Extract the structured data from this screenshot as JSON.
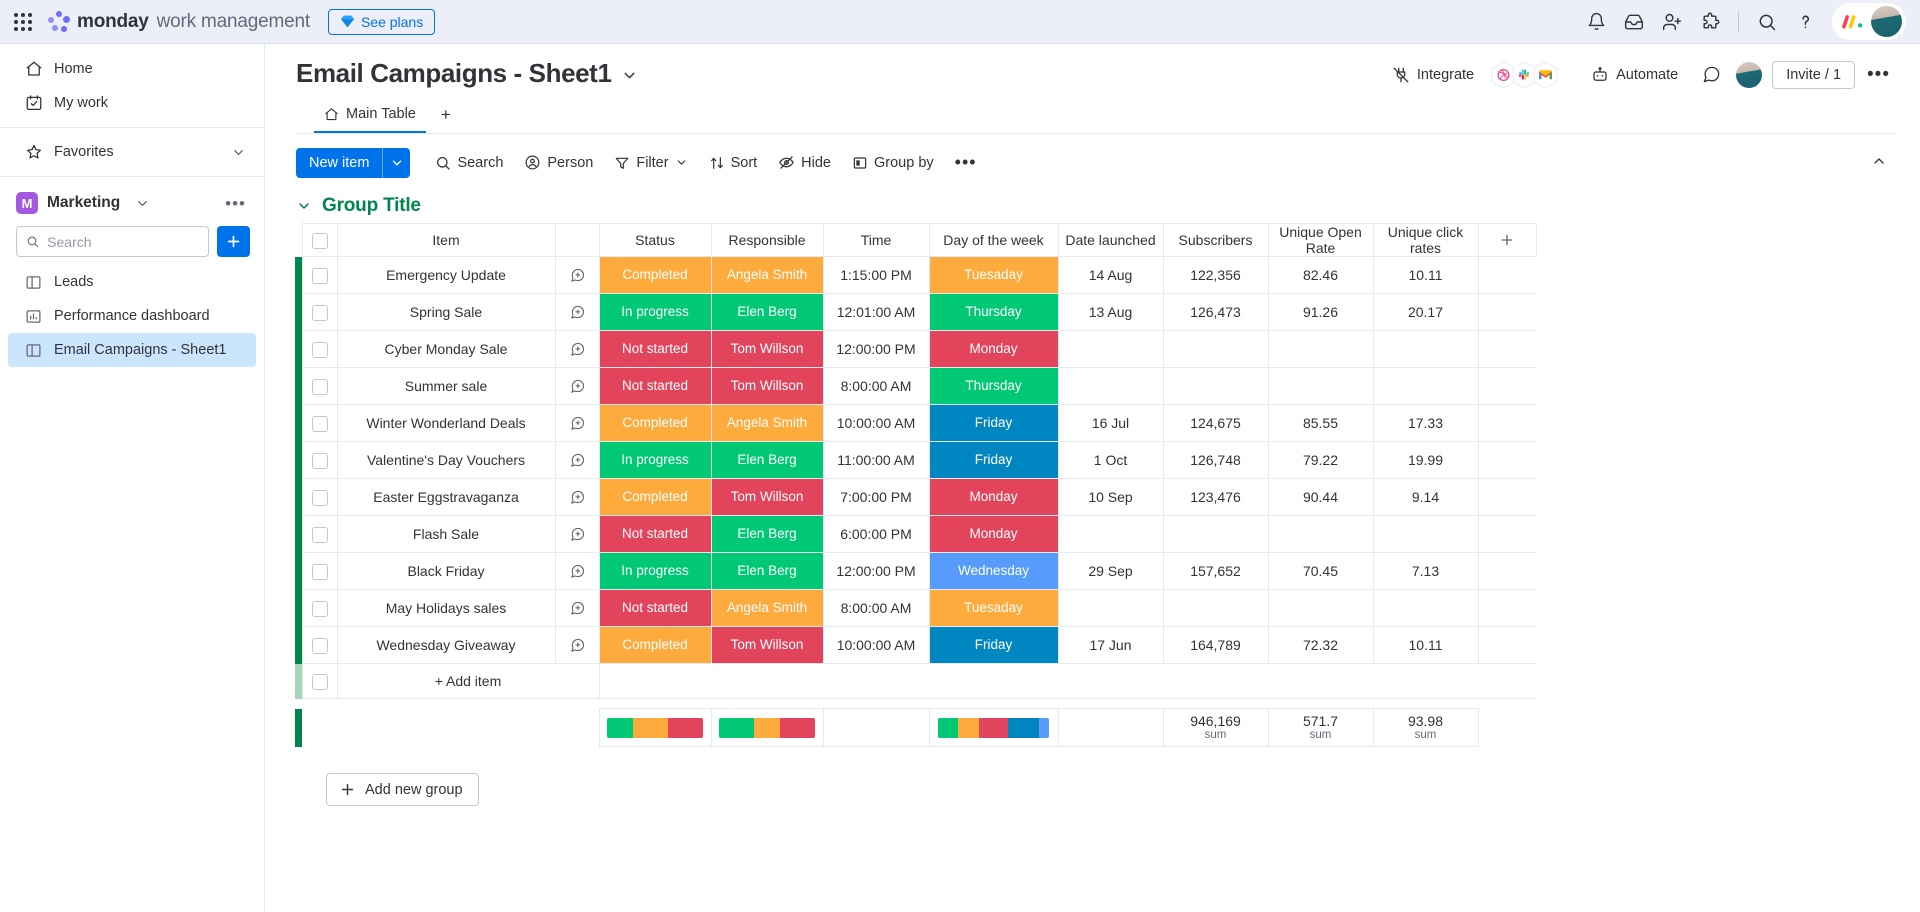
{
  "topbar": {
    "apps_icon": "apps-grid-icon",
    "brand_bold": "monday",
    "brand_light": "work management",
    "see_plans": "See plans",
    "icons": [
      "notifications-bell-icon",
      "inbox-icon",
      "invite-member-icon",
      "apps-puzzle-icon",
      "search-icon",
      "help-question-icon"
    ]
  },
  "sidebar": {
    "items": [
      {
        "label": "Home",
        "icon": "home-icon"
      },
      {
        "label": "My work",
        "icon": "my-work-icon"
      },
      {
        "label": "Favorites",
        "icon": "star-icon"
      }
    ],
    "workspace": {
      "badge": "M",
      "name": "Marketing"
    },
    "search_placeholder": "Search",
    "search_value": "",
    "add_label": "+",
    "boards": [
      {
        "label": "Leads",
        "icon": "board-icon",
        "active": false
      },
      {
        "label": "Performance dashboard",
        "icon": "dashboard-icon",
        "active": false
      },
      {
        "label": "Email Campaigns - Sheet1",
        "icon": "board-icon",
        "active": true
      }
    ]
  },
  "board": {
    "title": "Email Campaigns - Sheet1",
    "tabs": [
      {
        "label": "Main Table",
        "icon": "home-icon",
        "active": true
      }
    ],
    "tab_add": "+",
    "integrate_label": "Integrate",
    "integrate_apps": [
      "dribbble-icon",
      "slack-icon",
      "gmail-icon"
    ],
    "automate_label": "Automate",
    "comment_icon": "comment-icon",
    "invite_label": "Invite / 1",
    "more_label": "•••"
  },
  "toolbar": {
    "new_item": "New item",
    "buttons": [
      {
        "label": "Search",
        "icon": "search-icon",
        "chev": false
      },
      {
        "label": "Person",
        "icon": "person-icon",
        "chev": false
      },
      {
        "label": "Filter",
        "icon": "filter-icon",
        "chev": true
      },
      {
        "label": "Sort",
        "icon": "sort-icon",
        "chev": false
      },
      {
        "label": "Hide",
        "icon": "hide-eye-icon",
        "chev": false
      },
      {
        "label": "Group by",
        "icon": "group-by-icon",
        "chev": false
      }
    ],
    "more_label": "•••"
  },
  "group": {
    "title": "Group Title",
    "color": "#00854d"
  },
  "table": {
    "columns": [
      "Item",
      "Status",
      "Responsible",
      "Time",
      "Day of the week",
      "Date launched",
      "Subscribers",
      "Unique Open Rate",
      "Unique click rates"
    ],
    "add_column": "+",
    "add_item": "+ Add item",
    "rows": [
      {
        "item": "Emergency Update",
        "status": "Completed",
        "status_color": "#fdab3d",
        "responsible": "Angela Smith",
        "resp_color": "#fdab3d",
        "time": "1:15:00 PM",
        "dow": "Tuesaday",
        "dow_color": "#fdab3d",
        "date": "14 Aug",
        "subscribers": "122,356",
        "open_rate": "82.46",
        "click_rate": "10.11"
      },
      {
        "item": "Spring Sale",
        "status": "In progress",
        "status_color": "#00c875",
        "responsible": "Elen Berg",
        "resp_color": "#00c875",
        "time": "12:01:00 AM",
        "dow": "Thursday",
        "dow_color": "#00c875",
        "date": "13 Aug",
        "subscribers": "126,473",
        "open_rate": "91.26",
        "click_rate": "20.17"
      },
      {
        "item": "Cyber Monday Sale",
        "status": "Not started",
        "status_color": "#e2445c",
        "responsible": "Tom Willson",
        "resp_color": "#e2445c",
        "time": "12:00:00 PM",
        "dow": "Monday",
        "dow_color": "#e2445c",
        "date": "",
        "subscribers": "",
        "open_rate": "",
        "click_rate": ""
      },
      {
        "item": "Summer sale",
        "status": "Not started",
        "status_color": "#e2445c",
        "responsible": "Tom Willson",
        "resp_color": "#e2445c",
        "time": "8:00:00 AM",
        "dow": "Thursday",
        "dow_color": "#00c875",
        "date": "",
        "subscribers": "",
        "open_rate": "",
        "click_rate": ""
      },
      {
        "item": "Winter Wonderland Deals",
        "status": "Completed",
        "status_color": "#fdab3d",
        "responsible": "Angela Smith",
        "resp_color": "#fdab3d",
        "time": "10:00:00 AM",
        "dow": "Friday",
        "dow_color": "#0086c0",
        "date": "16 Jul",
        "subscribers": "124,675",
        "open_rate": "85.55",
        "click_rate": "17.33"
      },
      {
        "item": "Valentine's Day Vouchers",
        "status": "In progress",
        "status_color": "#00c875",
        "responsible": "Elen Berg",
        "resp_color": "#00c875",
        "time": "11:00:00 AM",
        "dow": "Friday",
        "dow_color": "#0086c0",
        "date": "1 Oct",
        "subscribers": "126,748",
        "open_rate": "79.22",
        "click_rate": "19.99"
      },
      {
        "item": "Easter Eggstravaganza",
        "status": "Completed",
        "status_color": "#fdab3d",
        "responsible": "Tom Willson",
        "resp_color": "#e2445c",
        "time": "7:00:00 PM",
        "dow": "Monday",
        "dow_color": "#e2445c",
        "date": "10 Sep",
        "subscribers": "123,476",
        "open_rate": "90.44",
        "click_rate": "9.14"
      },
      {
        "item": "Flash Sale",
        "status": "Not started",
        "status_color": "#e2445c",
        "responsible": "Elen Berg",
        "resp_color": "#00c875",
        "time": "6:00:00 PM",
        "dow": "Monday",
        "dow_color": "#e2445c",
        "date": "",
        "subscribers": "",
        "open_rate": "",
        "click_rate": ""
      },
      {
        "item": "Black Friday",
        "status": "In progress",
        "status_color": "#00c875",
        "responsible": "Elen Berg",
        "resp_color": "#00c875",
        "time": "12:00:00 PM",
        "dow": "Wednesday",
        "dow_color": "#579bfc",
        "date": "29 Sep",
        "subscribers": "157,652",
        "open_rate": "70.45",
        "click_rate": "7.13"
      },
      {
        "item": "May Holidays sales",
        "status": "Not started",
        "status_color": "#e2445c",
        "responsible": "Angela Smith",
        "resp_color": "#fdab3d",
        "time": "8:00:00 AM",
        "dow": "Tuesaday",
        "dow_color": "#fdab3d",
        "date": "",
        "subscribers": "",
        "open_rate": "",
        "click_rate": ""
      },
      {
        "item": "Wednesday Giveaway",
        "status": "Completed",
        "status_color": "#fdab3d",
        "responsible": "Tom Willson",
        "resp_color": "#e2445c",
        "time": "10:00:00 AM",
        "dow": "Friday",
        "dow_color": "#0086c0",
        "date": "17 Jun",
        "subscribers": "164,789",
        "open_rate": "72.32",
        "click_rate": "10.11"
      }
    ],
    "summary": {
      "status_bar": [
        {
          "color": "#00c875",
          "pct": 27.3
        },
        {
          "color": "#fdab3d",
          "pct": 36.4
        },
        {
          "color": "#e2445c",
          "pct": 36.3
        }
      ],
      "responsible_bar": [
        {
          "color": "#00c875",
          "pct": 36.4
        },
        {
          "color": "#fdab3d",
          "pct": 27.3
        },
        {
          "color": "#e2445c",
          "pct": 36.3
        }
      ],
      "dow_bar": [
        {
          "color": "#00c875",
          "pct": 18.2
        },
        {
          "color": "#fdab3d",
          "pct": 18.2
        },
        {
          "color": "#e2445c",
          "pct": 27.2
        },
        {
          "color": "#0086c0",
          "pct": 27.3
        },
        {
          "color": "#579bfc",
          "pct": 9.1
        }
      ],
      "subscribers_sum": "946,169",
      "open_rate_sum": "571.7",
      "click_rate_sum": "93.98",
      "sum_label": "sum"
    }
  },
  "footer": {
    "add_new_group": "Add new group"
  }
}
